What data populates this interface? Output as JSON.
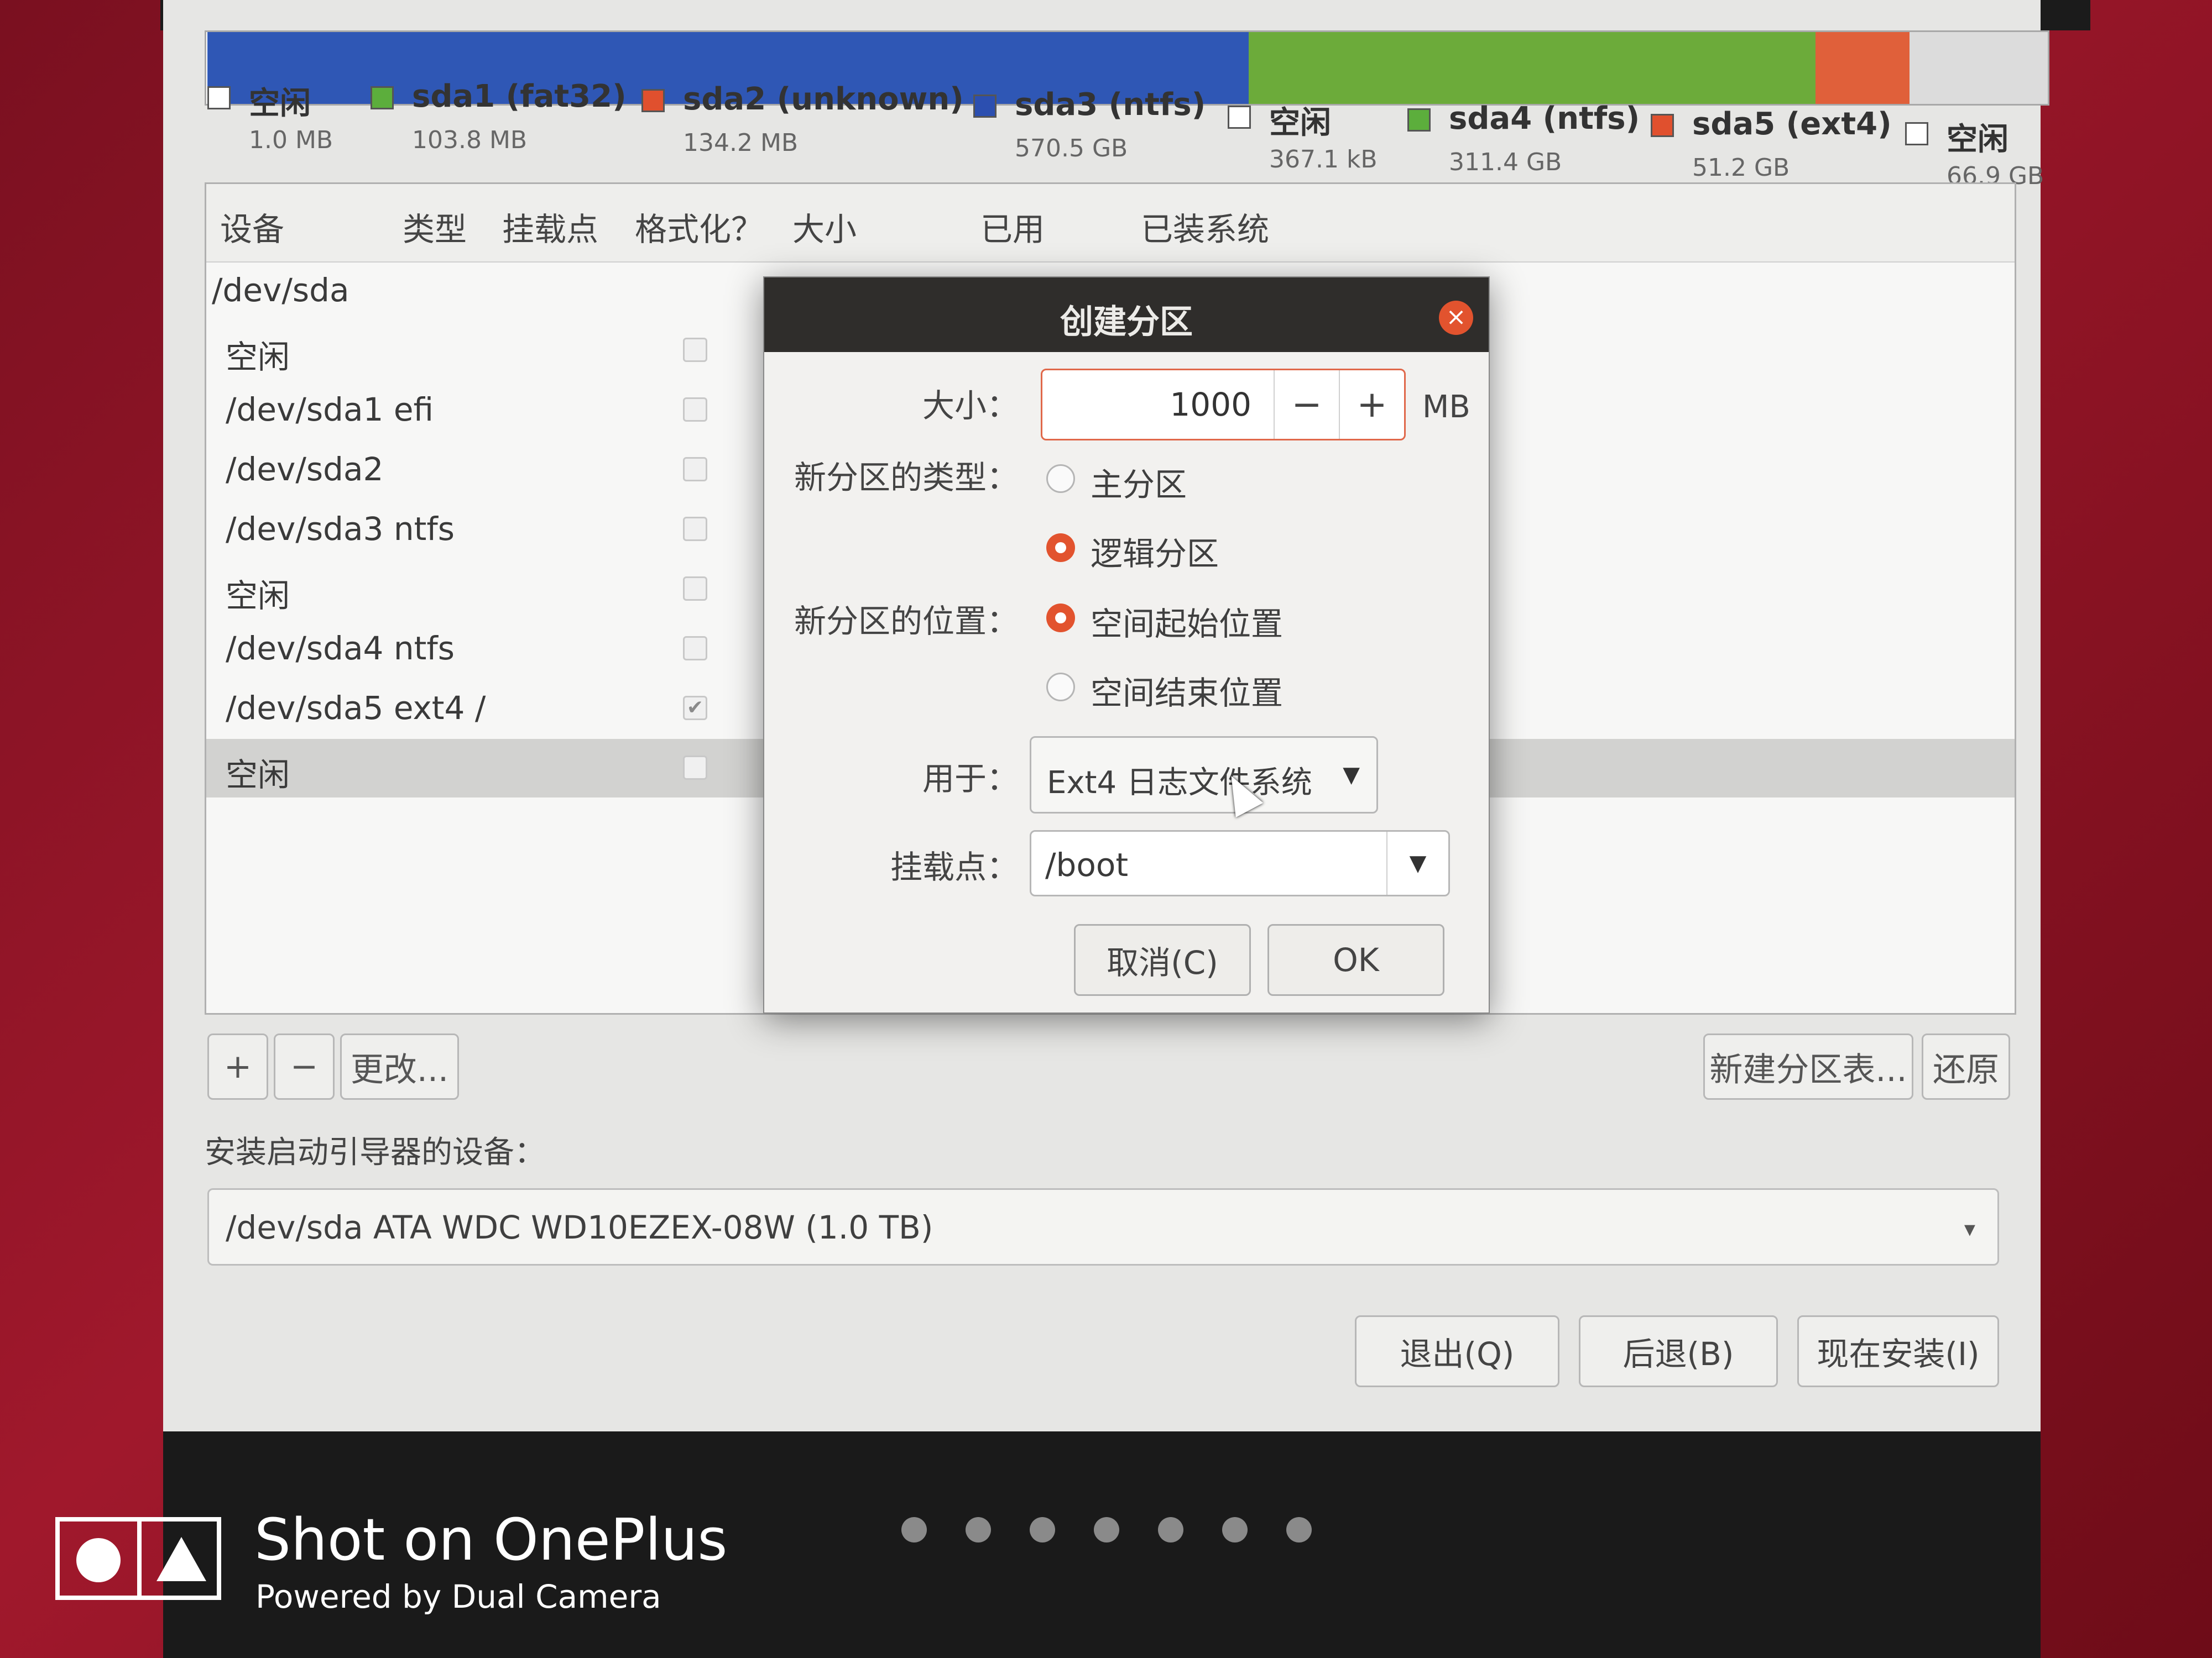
{
  "partition_bar": {
    "segments": [
      {
        "name": "空闲",
        "color": "#ffffff",
        "fraction": 0.0005
      },
      {
        "name": "sda1 (fat32)",
        "color": "#3d6ac8",
        "fraction": 0.0005
      },
      {
        "name": "sda3 (ntfs)",
        "color": "#2f57b5",
        "fraction": 0.565
      },
      {
        "name": "sda4 (ntfs)",
        "color": "#6cab3a",
        "fraction": 0.308
      },
      {
        "name": "sda5 (ext4)",
        "color": "#e0603a",
        "fraction": 0.051
      },
      {
        "name": "空闲",
        "color": "#dcdcdc",
        "fraction": 0.075
      }
    ],
    "legend": [
      {
        "name": "空闲",
        "size": "1.0 MB",
        "color": "#ffffff"
      },
      {
        "name": "sda1 (fat32)",
        "size": "103.8 MB",
        "color": "#5cae3c"
      },
      {
        "name": "sda2 (unknown)",
        "size": "134.2 MB",
        "color": "#e0502e"
      },
      {
        "name": "sda3 (ntfs)",
        "size": "570.5 GB",
        "color": "#2c4fb0"
      },
      {
        "name": "空闲",
        "size": "367.1 kB",
        "color": "#ffffff"
      },
      {
        "name": "sda4 (ntfs)",
        "size": "311.4 GB",
        "color": "#5cae3c"
      },
      {
        "name": "sda5 (ext4)",
        "size": "51.2 GB",
        "color": "#e0502e"
      },
      {
        "name": "空闲",
        "size": "66.9 GB",
        "color": "#ffffff"
      }
    ]
  },
  "table": {
    "headers": [
      "设备",
      "类型",
      "挂载点",
      "格式化？",
      "大小",
      "已用",
      "已装系统"
    ],
    "rows": [
      {
        "device": "/dev/sda",
        "format": "",
        "root": true
      },
      {
        "device": "空闲",
        "format": "",
        "root": false
      },
      {
        "device": "/dev/sda1 efi",
        "format": "",
        "root": false
      },
      {
        "device": "/dev/sda2",
        "format": "",
        "root": false
      },
      {
        "device": "/dev/sda3 ntfs",
        "format": "",
        "root": false
      },
      {
        "device": "空闲",
        "format": "",
        "root": false
      },
      {
        "device": "/dev/sda4 ntfs",
        "format": "",
        "root": false
      },
      {
        "device": "/dev/sda5 ext4    /",
        "format": "✔",
        "root": false
      },
      {
        "device": "空闲",
        "format": "",
        "root": false,
        "selected": true
      }
    ]
  },
  "table_buttons": {
    "add": "+",
    "remove": "−",
    "change": "更改..."
  },
  "right_buttons": {
    "new_table": "新建分区表...",
    "revert": "还原"
  },
  "boot": {
    "label": "安装启动引导器的设备：",
    "value": "/dev/sda   ATA WDC WD10EZEX-08W (1.0 TB)",
    "arrow": "▾"
  },
  "nav": {
    "quit": "退出(Q)",
    "back": "后退(B)",
    "install": "现在安装(I)"
  },
  "dialog": {
    "title": "创建分区",
    "close": "×",
    "size_label": "大小：",
    "size_value": "1000",
    "minus": "−",
    "plus": "+",
    "unit": "MB",
    "type_label": "新分区的类型：",
    "type_primary": "主分区",
    "type_logical": "逻辑分区",
    "location_label": "新分区的位置：",
    "location_start": "空间起始位置",
    "location_end": "空间结束位置",
    "use_label": "用于：",
    "use_value": "Ext4 日志文件系统",
    "mount_label": "挂载点：",
    "mount_value": "/boot",
    "dropdown_arrow": "▼",
    "cancel": "取消(C)",
    "ok": "OK"
  },
  "watermark": {
    "title": "Shot on OnePlus",
    "subtitle": "Powered by Dual Camera"
  },
  "slideshow_dots": 7
}
